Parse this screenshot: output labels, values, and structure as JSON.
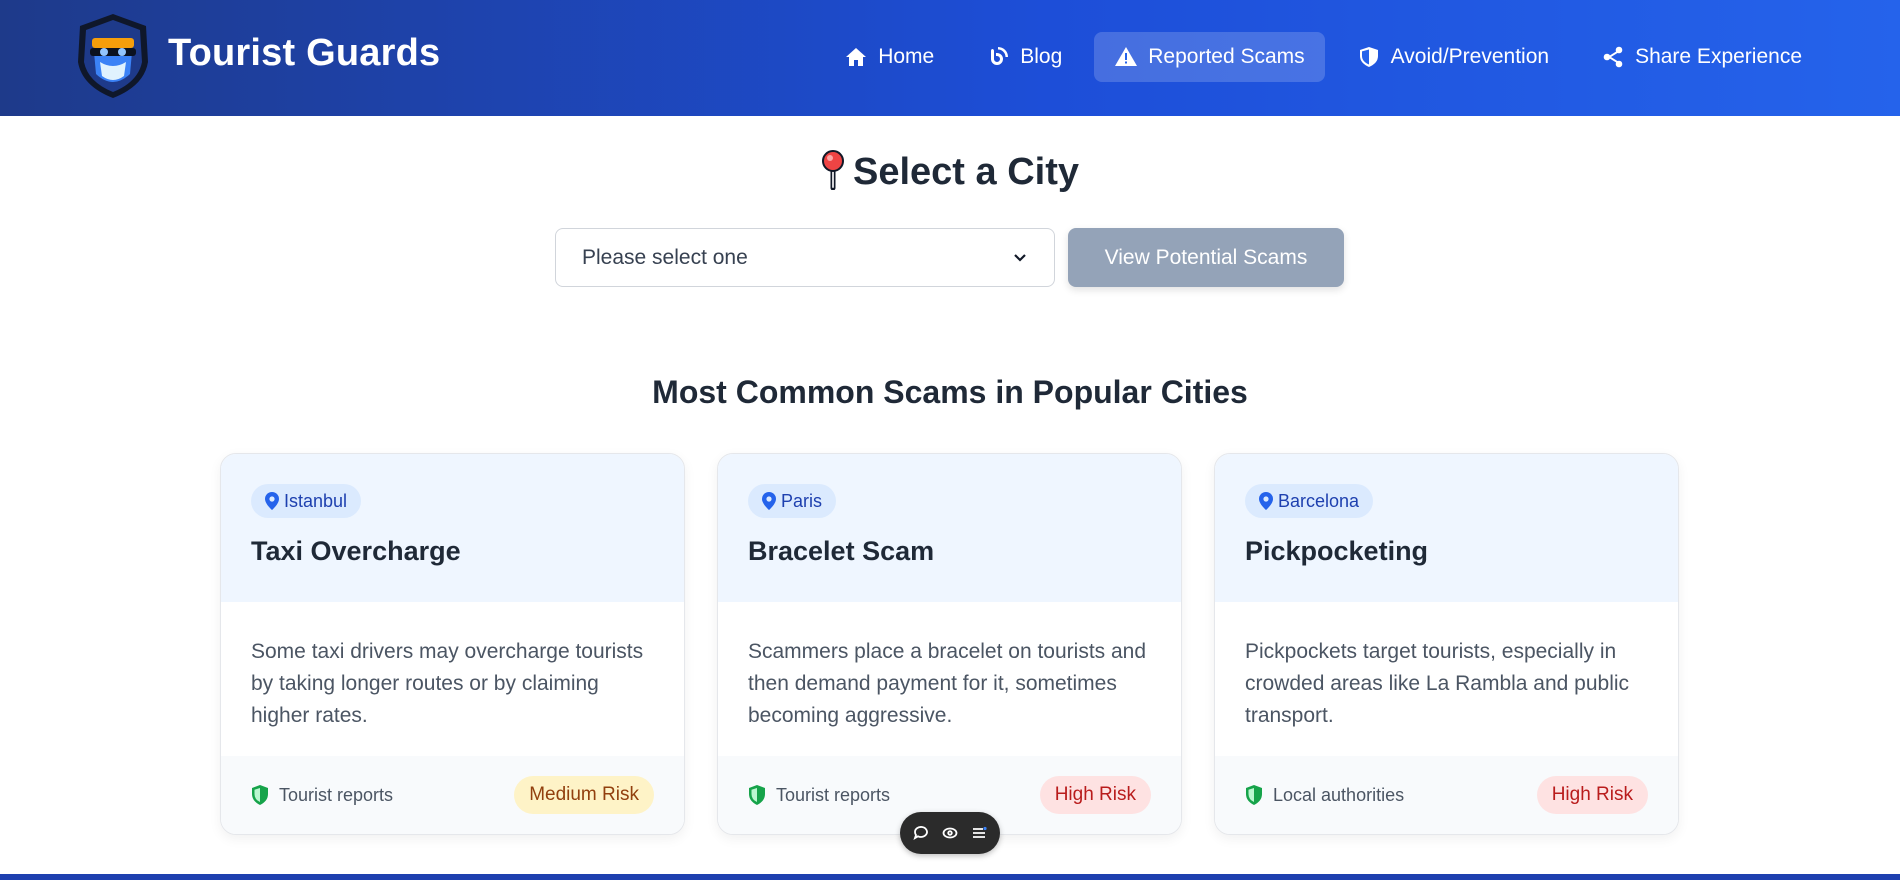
{
  "brand": {
    "name": "Tourist Guards"
  },
  "nav": [
    {
      "label": "Home",
      "icon": "home-icon"
    },
    {
      "label": "Blog",
      "icon": "blog-icon"
    },
    {
      "label": "Reported Scams",
      "icon": "warning-icon",
      "active": true
    },
    {
      "label": "Avoid/Prevention",
      "icon": "shield-icon"
    },
    {
      "label": "Share Experience",
      "icon": "share-icon"
    }
  ],
  "city_section": {
    "title": "Select a City",
    "select_value": "Please select one",
    "button_label": "View Potential Scams"
  },
  "common_section": {
    "title": "Most Common Scams in Popular Cities"
  },
  "cards": [
    {
      "city": "Istanbul",
      "title": "Taxi Overcharge",
      "description": "Some taxi drivers may overcharge tourists by taking longer routes or by claiming higher rates.",
      "source": "Tourist reports",
      "risk": "Medium Risk",
      "risk_level": "medium"
    },
    {
      "city": "Paris",
      "title": "Bracelet Scam",
      "description": "Scammers place a bracelet on tourists and then demand payment for it, sometimes becoming aggressive.",
      "source": "Tourist reports",
      "risk": "High Risk",
      "risk_level": "high"
    },
    {
      "city": "Barcelona",
      "title": "Pickpocketing",
      "description": "Pickpockets target tourists, especially in crowded areas like La Rambla and public transport.",
      "source": "Local authorities",
      "risk": "High Risk",
      "risk_level": "high"
    }
  ],
  "colors": {
    "header_start": "#1e3a8a",
    "header_end": "#2563eb",
    "medium_risk": "#fef3c7",
    "high_risk": "#fee2e2",
    "verified": "#16a34a"
  }
}
